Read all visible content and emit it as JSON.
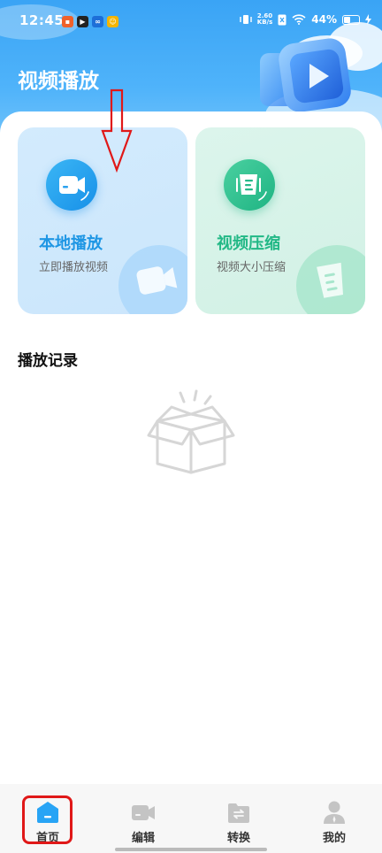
{
  "status_bar": {
    "time": "12:45",
    "network_speed_value": "2.60",
    "network_speed_unit": "KB/s",
    "battery_percent": "44%",
    "battery_level": 0.44
  },
  "header": {
    "title": "视频播放",
    "hero_icon": "play-icon"
  },
  "features": [
    {
      "title": "本地播放",
      "subtitle": "立即播放视频",
      "icon": "video-camera-icon",
      "accent": "#1e96e4"
    },
    {
      "title": "视频压缩",
      "subtitle": "视频大小压缩",
      "icon": "compress-icon",
      "accent": "#22b886"
    }
  ],
  "history": {
    "title": "播放记录",
    "empty_icon": "empty-box-icon"
  },
  "bottom_nav": [
    {
      "label": "首页",
      "icon": "home-icon",
      "active": true
    },
    {
      "label": "编辑",
      "icon": "edit-video-icon",
      "active": false
    },
    {
      "label": "转换",
      "icon": "convert-icon",
      "active": false
    },
    {
      "label": "我的",
      "icon": "profile-icon",
      "active": false
    }
  ],
  "colors": {
    "header_blue": "#3aa4f5",
    "active_nav": "#28a4f5",
    "annotation_red": "#e01818"
  }
}
